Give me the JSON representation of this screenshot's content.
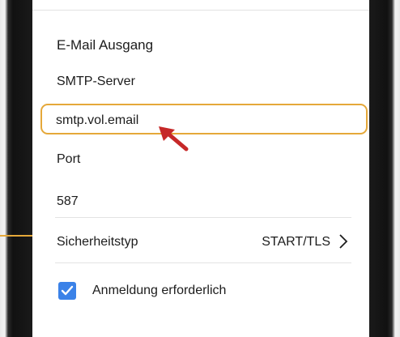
{
  "section": {
    "title": "E-Mail Ausgang"
  },
  "smtp": {
    "label": "SMTP-Server",
    "value": "smtp.vol.email"
  },
  "port": {
    "label": "Port",
    "value": "587"
  },
  "security": {
    "label": "Sicherheitstyp",
    "value": "START/TLS"
  },
  "auth": {
    "label": "Anmeldung erforderlich",
    "checked": true
  },
  "colors": {
    "highlight": "#e5a83a",
    "arrow": "#c62828",
    "checkbox": "#3b82e8"
  },
  "icons": {
    "pointer": "arrow-icon",
    "chevron": "chevron-right-icon",
    "check": "checkmark-icon"
  }
}
